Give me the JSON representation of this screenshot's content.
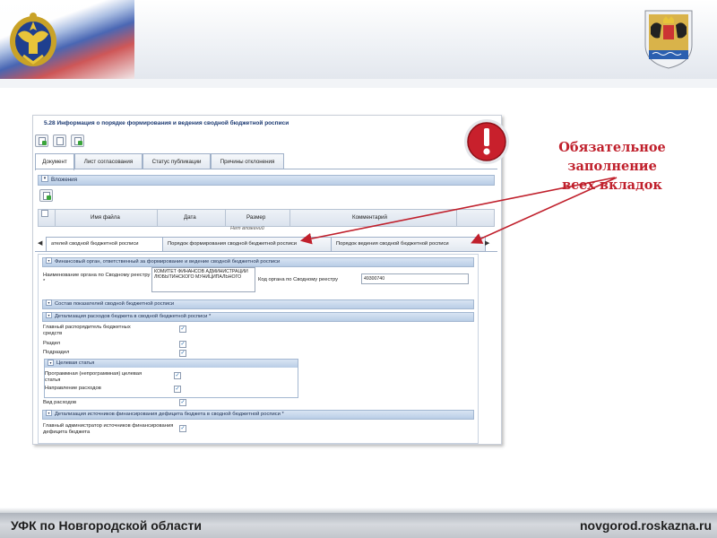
{
  "header": {
    "emblem_icon": "double-headed-eagle-emblem",
    "coat_of_arms_icon": "novgorod-coat-of-arms"
  },
  "screenshot": {
    "title": "5.28 Информация о порядке формирования и ведения сводной бюджетной росписи",
    "toolbar_icons": [
      "add-document-icon",
      "copy-document-icon",
      "save-document-icon"
    ],
    "tabs": [
      "Документ",
      "Лист согласования",
      "Статус публикации",
      "Причины отклонения"
    ],
    "attachments": {
      "section_label": "Вложения",
      "columns": [
        "Имя файла",
        "Дата",
        "Размер",
        "Комментарий"
      ],
      "empty_text": "Нет вложений"
    },
    "inner_tabs": [
      "ателей сводной бюджетной росписи",
      "Порядок формирования сводной бюджетной росписи",
      "Порядок ведения сводной бюджетной росписи"
    ],
    "form": {
      "section_org": "Финансовый орган, ответственный за формирование и ведение сводной бюджетной росписи",
      "org_name_label": "Наименование органа по Сводному реестру *",
      "org_name_value": "КОМИТЕТ ФИНАНСОВ АДМИНИСТРАЦИИ ЛЮБЫТИНСКОГО МУНИЦИПАЛЬНОГО",
      "org_code_label": "Код органа по Сводному реестру",
      "org_code_value": "49300740",
      "section_indicators": "Состав показателей сводной бюджетной росписи",
      "subsection_expenses": "Детализация расходов бюджета в сводной бюджетной росписи *",
      "expense_items": [
        "Главный распорядитель бюджетных средств",
        "Раздел",
        "Подраздел"
      ],
      "target_article_label": "Целевая статья",
      "target_items": [
        "Программная (непрограммная) целевая статья",
        "Направление расходов"
      ],
      "expense_type": "Вид расходов",
      "subsection_sources": "Детализация источников финансирования дефицита бюджета в сводной бюджетной росписи *",
      "source_item": "Главный администратор источников финансирования дефицита бюджета"
    }
  },
  "annotation": {
    "line1": "Обязательное заполнение",
    "line2": "всех вкладок",
    "icon": "exclamation-warning-icon",
    "color": "#c0202c"
  },
  "footer": {
    "left": "УФК по Новгородской области",
    "right": "novgorod.roskazna.ru"
  }
}
